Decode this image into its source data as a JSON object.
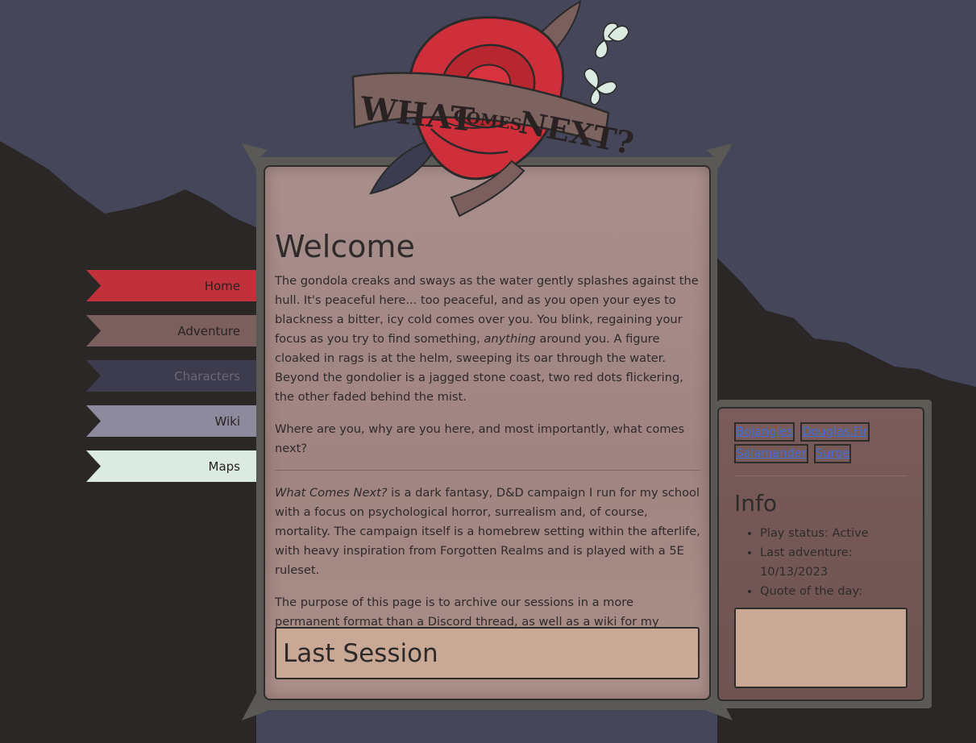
{
  "logo": {
    "word1": "WHAT",
    "word2": "COMES",
    "word3": "NEXT?"
  },
  "nav": {
    "items": [
      {
        "label": "Home",
        "color": "#c0313b",
        "text": "#2a2222"
      },
      {
        "label": "Adventure",
        "color": "#7a5f5c",
        "text": "#2a2222"
      },
      {
        "label": "Characters",
        "color": "#3d3c4f",
        "text": "#666070"
      },
      {
        "label": "Wiki",
        "color": "#8c8a9c",
        "text": "#2a2222"
      },
      {
        "label": "Maps",
        "color": "#dcebe1",
        "text": "#2a2222"
      }
    ]
  },
  "main": {
    "title": "Welcome",
    "p1": "The gondola creaks and sways as the water gently splashes against the hull. It's peaceful here... too peaceful, and as you open your eyes to blackness a bitter, icy cold comes over you. You blink, regaining your focus as you try to find something, ",
    "p1_em": "anything",
    "p1_rest": " around you. A figure cloaked in rags is at the helm, sweeping its oar through the water. Beyond the gondolier is a jagged stone coast, two red dots flickering, the other faded behind the mist.",
    "p2": "Where are you, why are you here, and most importantly, what comes next?",
    "p3_em": "What Comes Next?",
    "p3_rest": " is a dark fantasy, D&D campaign I run for my school with a focus on psychological horror, surrealism and, of course, mortality. The campaign itself is a homebrew setting within the afterlife, with heavy inspiration from Forgotten Realms and is played with a 5E ruleset.",
    "p4": "The purpose of this page is to archive our sessions in a more permanent format than a Discord thread, as well as a wiki for my players to access important worldbuilding info as they discover it!",
    "last_session_title": "Last Session"
  },
  "side": {
    "characters": [
      "Bojangles",
      "Douglas.Fir",
      "Salamander",
      "Surge"
    ],
    "info_title": "Info",
    "info_items": [
      "Play status: Active",
      "Last adventure: 10/13/2023",
      "Quote of the day:"
    ]
  },
  "colors": {
    "sky": "#45465a",
    "ground": "#2b2727",
    "panel": "#a3898a",
    "frame": "#5a5955",
    "link": "#3f6fd8"
  }
}
